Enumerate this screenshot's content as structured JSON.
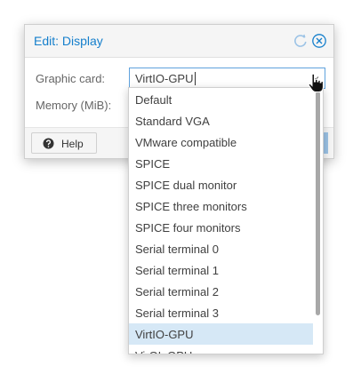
{
  "dialog": {
    "title": "Edit: Display",
    "fields": {
      "graphic_card_label": "Graphic card:",
      "graphic_card_value": "VirtIO-GPU",
      "memory_label": "Memory (MiB):"
    },
    "footer": {
      "help_label": "Help"
    }
  },
  "dropdown": {
    "items": [
      "Default",
      "Standard VGA",
      "VMware compatible",
      "SPICE",
      "SPICE dual monitor",
      "SPICE three monitors",
      "SPICE four monitors",
      "Serial terminal 0",
      "Serial terminal 1",
      "Serial terminal 2",
      "Serial terminal 3",
      "VirtIO-GPU",
      "VirGL GPU"
    ],
    "selected": "VirtIO-GPU"
  },
  "icons": {
    "reset": "reset-icon",
    "close": "close-icon",
    "help": "question-circle-icon",
    "trigger": "chevron-down-icon",
    "cursor": "hand-pointer-icon"
  },
  "colors": {
    "accent": "#157fcc",
    "selected_row": "#d6e8f6",
    "focus_border": "#5fa2dd"
  }
}
